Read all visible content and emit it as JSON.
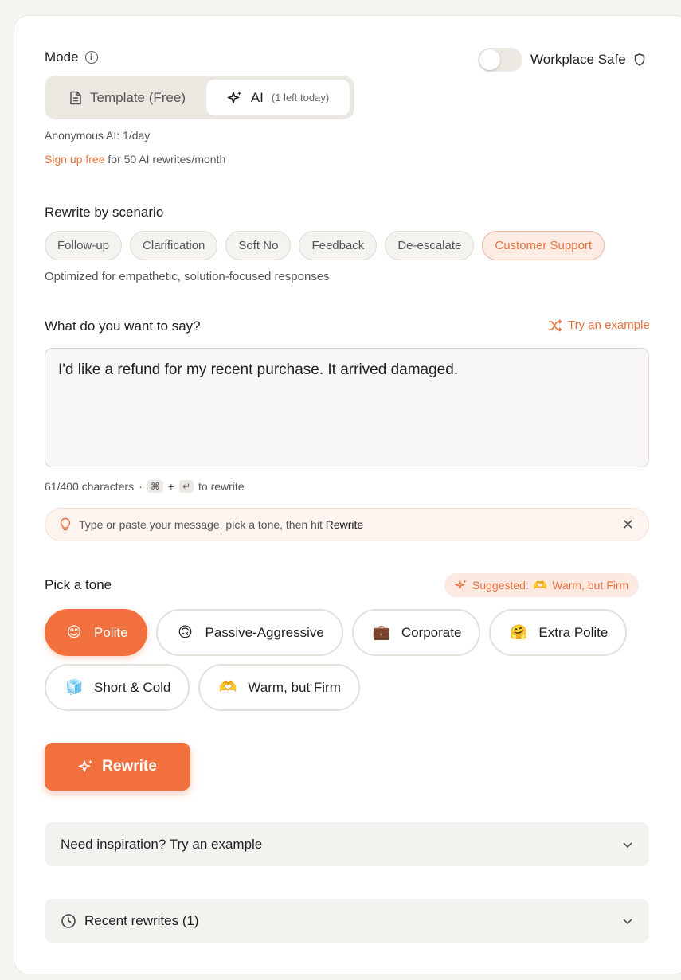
{
  "mode": {
    "label": "Mode",
    "info_icon": "info-icon",
    "workplace_safe_label": "Workplace Safe",
    "workplace_safe_on": false,
    "template_label": "Template (Free)",
    "ai_label": "AI",
    "ai_sub": "(1 left today)",
    "anon_text": "Anonymous AI: 1/day",
    "signup_link": "Sign up free",
    "signup_rest": "for 50 AI rewrites/month"
  },
  "scenario": {
    "title": "Rewrite by scenario",
    "chips": [
      "Follow-up",
      "Clarification",
      "Soft No",
      "Feedback",
      "De-escalate",
      "Customer Support"
    ],
    "selected": "Customer Support",
    "description": "Optimized for empathetic, solution-focused responses"
  },
  "input": {
    "title": "What do you want to say?",
    "try_example": "Try an example",
    "value": "I'd like a refund for my recent purchase. It arrived damaged.",
    "counter": "61/400 characters",
    "dot": "·",
    "kbd_cmd": "⌘",
    "plus": "+",
    "kbd_enter": "↵",
    "to_rewrite": "to rewrite",
    "hint_text": "Type or paste your message, pick a tone, then hit",
    "hint_strong": "Rewrite"
  },
  "tone": {
    "title": "Pick a tone",
    "suggested_label": "Suggested:",
    "suggested_emoji": "🫶",
    "suggested_value": "Warm, but Firm",
    "options": [
      {
        "emoji": "😊",
        "label": "Polite"
      },
      {
        "emoji": "🙃",
        "label": "Passive-Aggressive"
      },
      {
        "emoji": "💼",
        "label": "Corporate"
      },
      {
        "emoji": "🤗",
        "label": "Extra Polite"
      },
      {
        "emoji": "🧊",
        "label": "Short & Cold"
      },
      {
        "emoji": "🫶",
        "label": "Warm, but Firm"
      }
    ],
    "selected": "Polite"
  },
  "rewrite_button": "Rewrite",
  "accordions": {
    "inspiration": "Need inspiration? Try an example",
    "recent": "Recent rewrites (1)"
  },
  "colors": {
    "accent": "#f2703d",
    "accent_text": "#e8703c"
  }
}
